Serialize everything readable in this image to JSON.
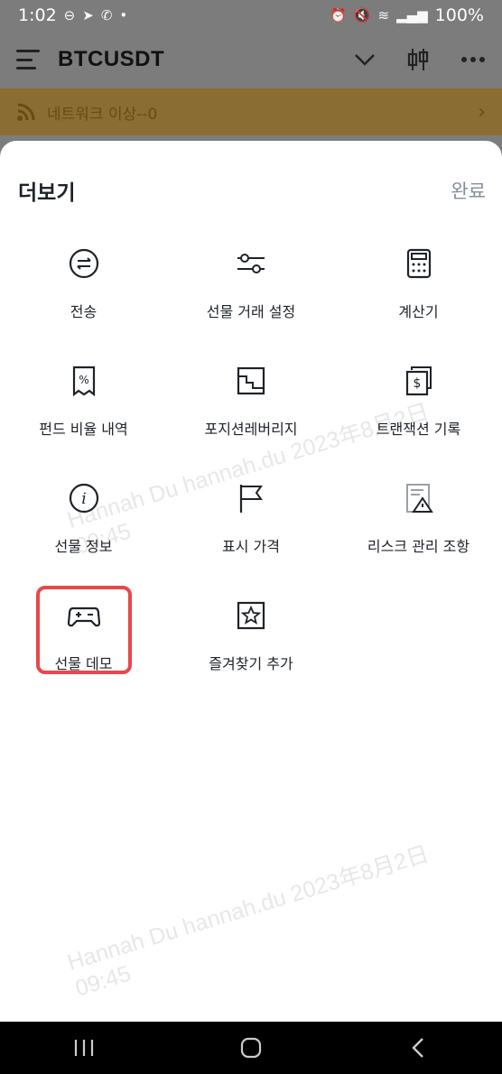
{
  "status_bar": {
    "time": "1:02",
    "battery": "100%",
    "icons": [
      "minus-circle-icon",
      "telegram-icon",
      "whatsapp-icon",
      "dot-icon",
      "alarm-icon",
      "mute-icon",
      "wifi-icon",
      "hd-voice-icon",
      "signal-icon"
    ]
  },
  "header": {
    "symbol": "BTCUSDT",
    "icons": [
      "menu-icon",
      "chevron-down-icon",
      "candlestick-icon",
      "more-icon"
    ]
  },
  "alert": {
    "text": "네트워크 이상--0"
  },
  "sheet": {
    "title": "더보기",
    "done_label": "완료",
    "items": [
      {
        "label": "전송",
        "icon": "transfer-icon"
      },
      {
        "label": "선물 거래 설정",
        "icon": "sliders-icon"
      },
      {
        "label": "계산기",
        "icon": "calculator-icon"
      },
      {
        "label": "펀드 비율 내역",
        "icon": "funding-rate-icon"
      },
      {
        "label": "포지션레버리지",
        "icon": "leverage-icon"
      },
      {
        "label": "트랜잭션 기록",
        "icon": "transaction-history-icon"
      },
      {
        "label": "선물 정보",
        "icon": "info-icon"
      },
      {
        "label": "표시 가격",
        "icon": "flag-icon"
      },
      {
        "label": "리스크 관리 조항",
        "icon": "risk-warning-icon"
      },
      {
        "label": "선물 데모",
        "icon": "gamepad-icon"
      },
      {
        "label": "즐겨찾기 추가",
        "icon": "star-icon"
      }
    ]
  },
  "watermark": {
    "line1": "Hannah Du hannah.du 2023年8月2日",
    "line2": "09:45"
  },
  "colors": {
    "highlight": "#e8474c",
    "alert_bg": "#8a6d32",
    "muted": "#848e9c"
  }
}
